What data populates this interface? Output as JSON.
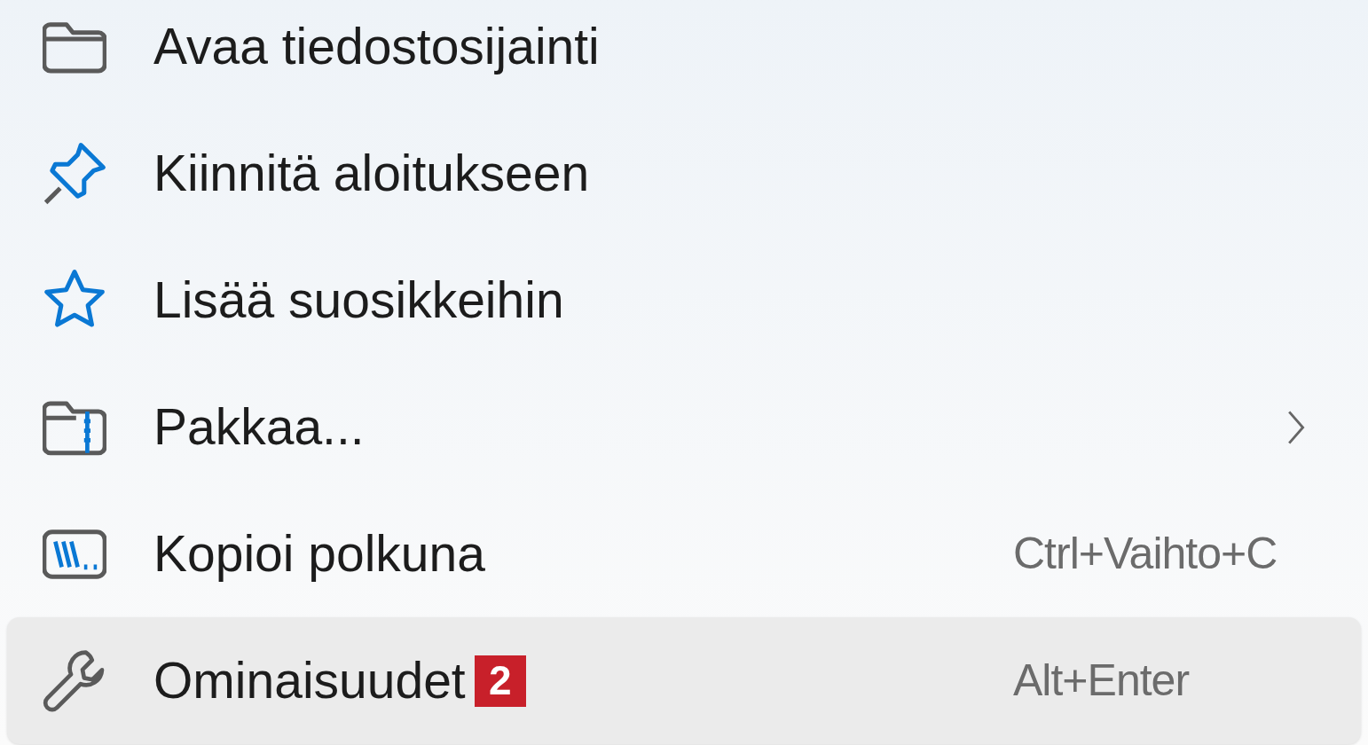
{
  "menu": {
    "items": [
      {
        "label": "Avaa tiedostosijainti",
        "selected": false
      },
      {
        "label": "Kiinnitä aloitukseen",
        "selected": false
      },
      {
        "label": "Lisää suosikkeihin",
        "selected": false
      },
      {
        "label": "Pakkaa...",
        "submenu": true,
        "selected": false
      },
      {
        "label": "Kopioi polkuna",
        "shortcut": "Ctrl+Vaihto+C",
        "selected": false
      },
      {
        "label": "Ominaisuudet",
        "shortcut": "Alt+Enter",
        "badge": "2",
        "selected": true
      }
    ]
  }
}
